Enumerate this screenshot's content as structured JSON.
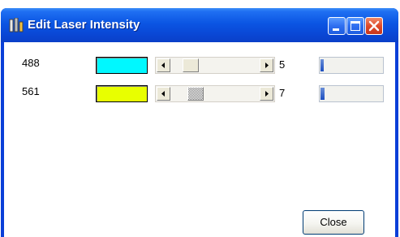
{
  "window": {
    "title": "Edit Laser Intensity",
    "close_button_label": "Close"
  },
  "icons": {
    "app": "laser-app-icon",
    "minimize": "minimize-icon",
    "maximize": "maximize-icon",
    "close": "close-x-icon",
    "scroll_left": "arrow-left-icon",
    "scroll_right": "arrow-right-icon"
  },
  "lasers": [
    {
      "wavelength": "488",
      "color": "#00f8ff",
      "intensity": "5",
      "level_fraction": 0.05,
      "thumb_position_fraction": 0.05
    },
    {
      "wavelength": "561",
      "color": "#e8ff00",
      "intensity": "7",
      "level_fraction": 0.07,
      "thumb_position_fraction": 0.07
    }
  ],
  "colors": {
    "titlebar": "#0b55e3",
    "level_fill": "#1d4fc0"
  }
}
